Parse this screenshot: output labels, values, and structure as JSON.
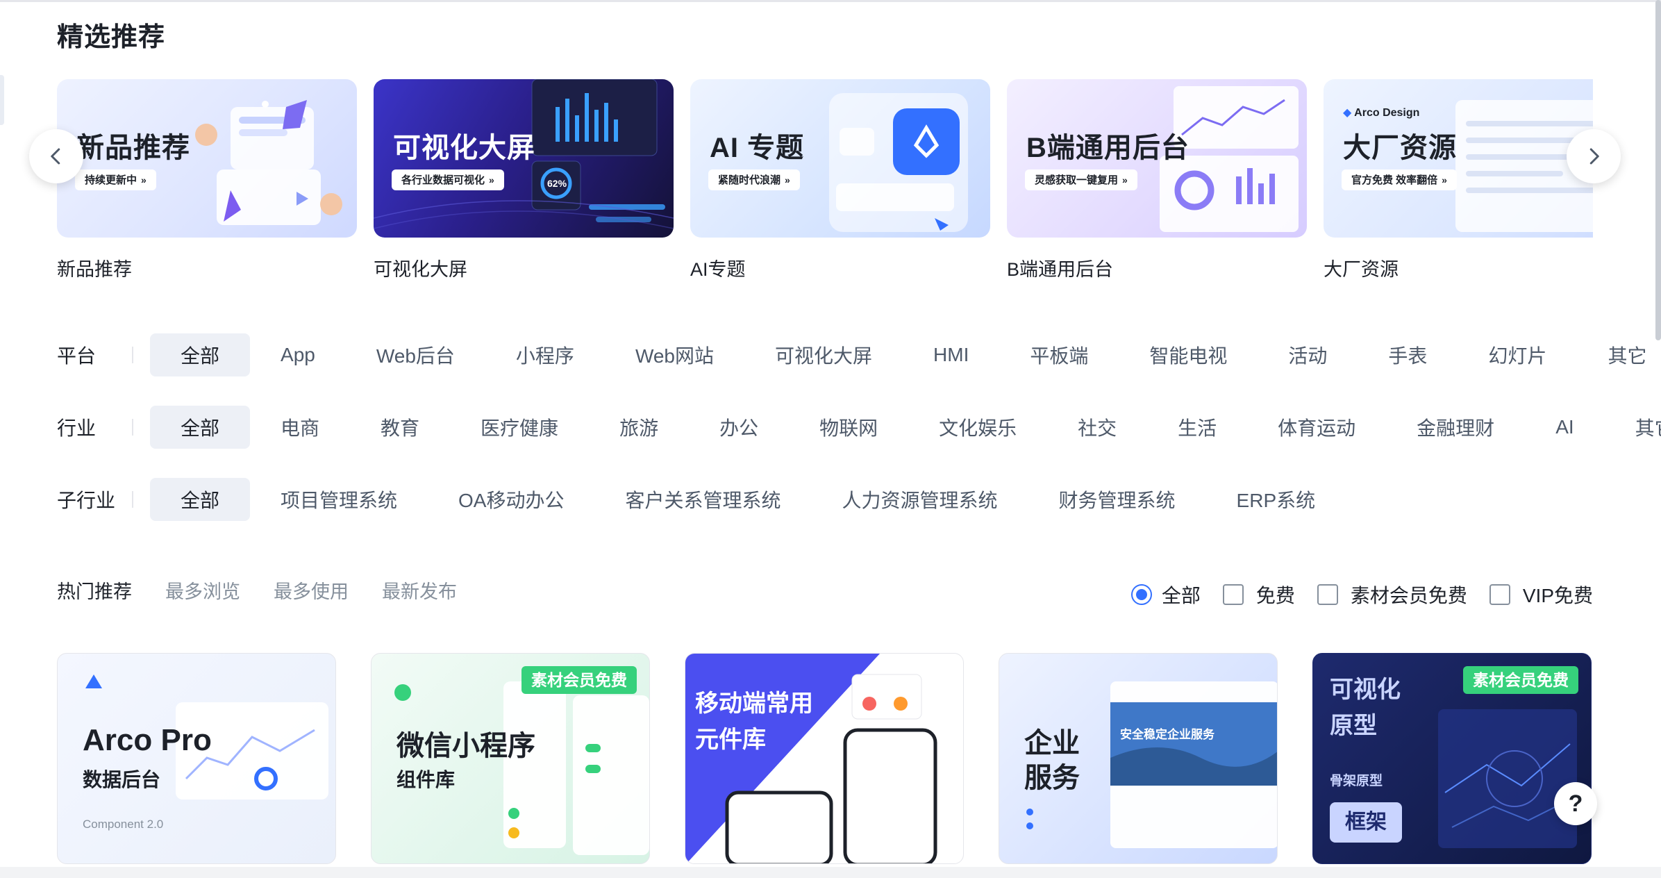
{
  "section_title": "精选推荐",
  "banners": [
    {
      "headline": "新品推荐",
      "tag": "持续更新中",
      "caption": "新品推荐"
    },
    {
      "headline": "可视化大屏",
      "tag": "各行业数据可视化",
      "caption": "可视化大屏",
      "gauge": "62%"
    },
    {
      "headline": "AI 专题",
      "tag": "紧随时代浪潮",
      "caption": "AI专题"
    },
    {
      "headline": "B端通用后台",
      "tag": "灵感获取一键复用",
      "caption": "B端通用后台"
    },
    {
      "headline": "大厂资源",
      "tag": "官方免费 效率翻倍",
      "caption": "大厂资源",
      "brand": "Arco Design"
    }
  ],
  "filters": {
    "platform": {
      "label": "平台",
      "options": [
        "全部",
        "App",
        "Web后台",
        "小程序",
        "Web网站",
        "可视化大屏",
        "HMI",
        "平板端",
        "智能电视",
        "活动",
        "手表",
        "幻灯片",
        "其它"
      ],
      "selected": "全部"
    },
    "industry": {
      "label": "行业",
      "options": [
        "全部",
        "电商",
        "教育",
        "医疗健康",
        "旅游",
        "办公",
        "物联网",
        "文化娱乐",
        "社交",
        "生活",
        "体育运动",
        "金融理财",
        "AI",
        "其它"
      ],
      "selected": "全部"
    },
    "sub_industry": {
      "label": "子行业",
      "options": [
        "全部",
        "项目管理系统",
        "OA移动办公",
        "客户关系管理系统",
        "人力资源管理系统",
        "财务管理系统",
        "ERP系统"
      ],
      "selected": "全部"
    }
  },
  "sort_tabs": [
    "热门推荐",
    "最多浏览",
    "最多使用",
    "最新发布"
  ],
  "sort_selected": "热门推荐",
  "type_filter": {
    "all": "全部",
    "free": "免费",
    "member_free": "素材会员免费",
    "vip_free": "VIP免费"
  },
  "cards": [
    {
      "title": "Arco Pro",
      "subtitle": "数据后台",
      "note": "Component 2.0"
    },
    {
      "title": "微信小程序",
      "subtitle": "组件库",
      "badge": "素材会员免费"
    },
    {
      "title": "移动端常用",
      "subtitle": "元件库"
    },
    {
      "title": "企业",
      "subtitle": "服务",
      "hero": "安全稳定企业服务"
    },
    {
      "title": "可视化",
      "subtitle": "原型",
      "line3": "骨架原型",
      "button": "框架",
      "badge": "素材会员免费"
    }
  ],
  "help": "?",
  "colors": {
    "accent": "#3370ff",
    "badge_green": "#36d17c",
    "chip_active_bg": "#edf0f6"
  }
}
